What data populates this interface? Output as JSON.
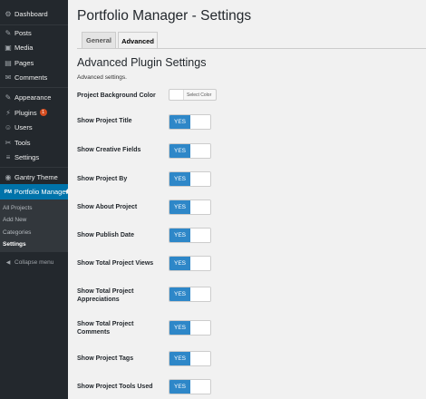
{
  "sidebar": {
    "items": [
      {
        "label": "Dashboard",
        "icon": "dashboard-icon",
        "glyph": "⚙"
      },
      {
        "label": "Posts",
        "icon": "pin-icon",
        "glyph": "✎"
      },
      {
        "label": "Media",
        "icon": "media-icon",
        "glyph": "▣"
      },
      {
        "label": "Pages",
        "icon": "pages-icon",
        "glyph": "▤"
      },
      {
        "label": "Comments",
        "icon": "comments-icon",
        "glyph": "✉"
      },
      {
        "label": "Appearance",
        "icon": "appearance-icon",
        "glyph": "✎"
      },
      {
        "label": "Plugins",
        "icon": "plugins-icon",
        "glyph": "⚡",
        "badge": "1"
      },
      {
        "label": "Users",
        "icon": "users-icon",
        "glyph": "☺"
      },
      {
        "label": "Tools",
        "icon": "tools-icon",
        "glyph": "✂"
      },
      {
        "label": "Settings",
        "icon": "settings-icon",
        "glyph": "≡"
      },
      {
        "label": "Gantry Theme",
        "icon": "gantry-icon",
        "glyph": "◉"
      },
      {
        "label": "Portfolio Manager",
        "icon": "portfolio-icon",
        "glyph": "PM"
      }
    ],
    "submenu": [
      "All Projects",
      "Add New",
      "Categories",
      "Settings"
    ],
    "collapse_label": "Collapse menu",
    "collapse_glyph": "◀"
  },
  "header": {
    "title": "Portfolio Manager - Settings"
  },
  "tabs": [
    {
      "label": "General"
    },
    {
      "label": "Advanced"
    }
  ],
  "section": {
    "heading": "Advanced Plugin Settings",
    "description": "Advanced settings."
  },
  "color_field": {
    "label": "Project Background Color",
    "button_text": "Select Color"
  },
  "toggle_text": "YES",
  "settings": [
    {
      "label": "Show Project Title",
      "value": "YES"
    },
    {
      "label": "Show Creative Fields",
      "value": "YES"
    },
    {
      "label": "Show Project By",
      "value": "YES"
    },
    {
      "label": "Show About Project",
      "value": "YES"
    },
    {
      "label": "Show Publish Date",
      "value": "YES"
    },
    {
      "label": "Show Total Project Views",
      "value": "YES"
    },
    {
      "label": "Show Total Project Appreciations",
      "value": "YES"
    },
    {
      "label": "Show Total Project Comments",
      "value": "YES"
    },
    {
      "label": "Show Project Tags",
      "value": "YES"
    },
    {
      "label": "Show Project Tools Used",
      "value": "YES"
    }
  ],
  "colors": {
    "sidebar_bg": "#23282d",
    "submenu_bg": "#32373c",
    "active_blue": "#0073aa",
    "toggle_on": "#2e87c8",
    "page_bg": "#f1f1f1",
    "badge": "#d54e21"
  }
}
